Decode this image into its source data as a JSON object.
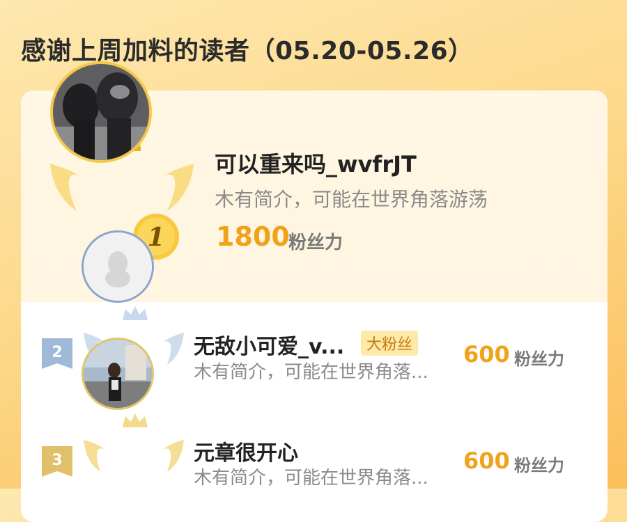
{
  "header": {
    "title": "感谢上周加料的读者（05.20-05.26）"
  },
  "leaderboard": {
    "score_unit": "粉丝力",
    "entries": [
      {
        "rank": "1",
        "name": "可以重来吗_wvfrJT",
        "intro": "木有简介，可能在世界角落游荡",
        "score": "1800"
      },
      {
        "rank": "2",
        "name": "无敌小可爱_v...",
        "tag": "大粉丝",
        "intro": "木有简介，可能在世界角落...",
        "score": "600"
      },
      {
        "rank": "3",
        "name": "元章很开心",
        "intro": "木有简介，可能在世界角落...",
        "score": "600"
      }
    ]
  },
  "colors": {
    "accent": "#f1a21b",
    "gold": "#f4c84a",
    "silver": "#8aa6cf",
    "bronze": "#e3c56a"
  }
}
